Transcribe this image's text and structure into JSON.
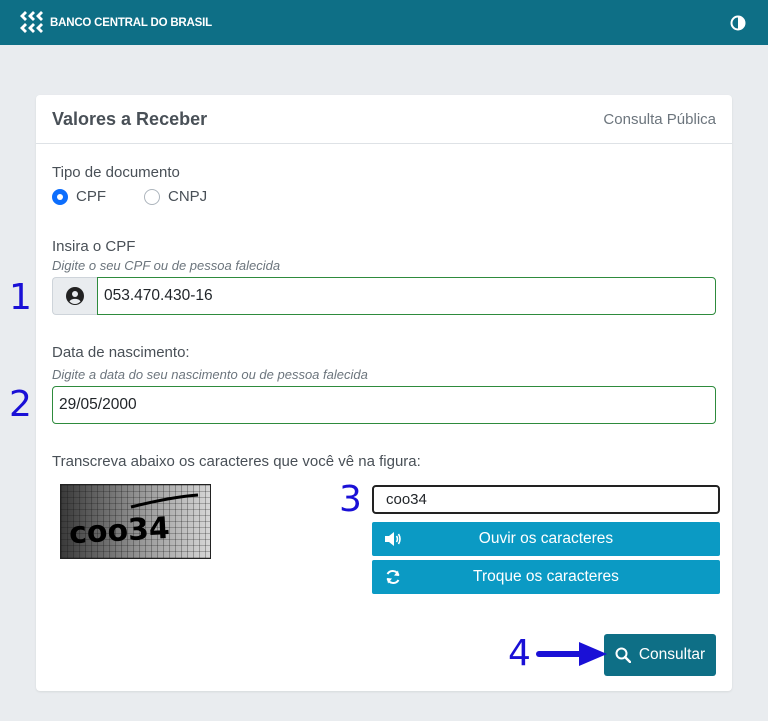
{
  "header": {
    "brand_name": "BANCO CENTRAL DO BRASIL",
    "logo_icon": "bcb-logo-icon",
    "contrast_icon": "contrast-icon",
    "color": "#0e6f86"
  },
  "card": {
    "title": "Valores a Receber",
    "subtitle": "Consulta Pública"
  },
  "document_type": {
    "label": "Tipo de documento",
    "options": [
      {
        "label": "CPF",
        "checked": true
      },
      {
        "label": "CNPJ",
        "checked": false
      }
    ]
  },
  "cpf": {
    "label": "Insira o CPF",
    "hint": "Digite o seu CPF ou de pessoa falecida",
    "value": "053.470.430-16",
    "addon_icon": "user-circle-icon"
  },
  "birth_date": {
    "label": "Data de nascimento:",
    "hint": "Digite a data do seu nascimento ou de pessoa falecida",
    "value": "29/05/2000"
  },
  "captcha": {
    "instruction": "Transcreva abaixo os caracteres que você vê na figura:",
    "image_text": "coo34",
    "value": "coo34",
    "listen_label": "Ouvir os caracteres",
    "listen_icon": "speaker-icon",
    "refresh_label": "Troque os caracteres",
    "refresh_icon": "refresh-icon",
    "button_color": "#0b9ac4"
  },
  "submit": {
    "label": "Consultar",
    "icon": "search-icon"
  },
  "annotations": {
    "step1": "1",
    "step2": "2",
    "step3": "3",
    "step4": "4",
    "color": "#1a10d6"
  }
}
